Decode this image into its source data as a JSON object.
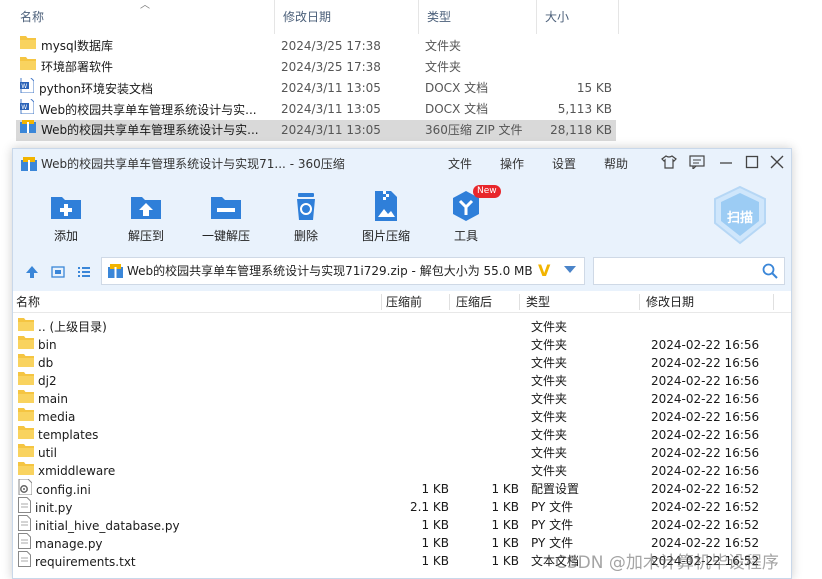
{
  "explorer": {
    "columns": {
      "name": "名称",
      "date": "修改日期",
      "type": "类型",
      "size": "大小"
    },
    "rows": [
      {
        "icon": "folder-icon",
        "name": "mysql数据库",
        "date": "2024/3/25 17:38",
        "type": "文件夹",
        "size": ""
      },
      {
        "icon": "folder-icon",
        "name": "环境部署软件",
        "date": "2024/3/25 17:38",
        "type": "文件夹",
        "size": ""
      },
      {
        "icon": "word-doc-icon",
        "name": "python环境安装文档",
        "date": "2024/3/11 13:05",
        "type": "DOCX 文档",
        "size": "15 KB"
      },
      {
        "icon": "word-doc-icon",
        "name": "Web的校园共享单车管理系统设计与实...",
        "date": "2024/3/11 13:05",
        "type": "DOCX 文档",
        "size": "5,113 KB"
      },
      {
        "icon": "zip-icon",
        "name": "Web的校园共享单车管理系统设计与实...",
        "date": "2024/3/11 13:05",
        "type": "360压缩 ZIP 文件",
        "size": "28,118 KB",
        "selected": true
      }
    ]
  },
  "zip": {
    "title": "Web的校园共享单车管理系统设计与实现71... - 360压缩",
    "menu": [
      "文件",
      "操作",
      "设置",
      "帮助"
    ],
    "toolbar": [
      {
        "icon": "add-icon",
        "label": "添加"
      },
      {
        "icon": "extract-to-icon",
        "label": "解压到"
      },
      {
        "icon": "one-click-extract-icon",
        "label": "一键解压"
      },
      {
        "icon": "delete-icon",
        "label": "删除"
      },
      {
        "icon": "image-compress-icon",
        "label": "图片压缩"
      },
      {
        "icon": "tools-icon",
        "label": "工具",
        "badge": "New"
      }
    ],
    "scan_label": "扫描",
    "address": "Web的校园共享单车管理系统设计与实现71i729.zip - 解包大小为 55.0 MB",
    "search_placeholder": "",
    "columns": {
      "name": "名称",
      "csize": "压缩前",
      "osize": "压缩后",
      "type": "类型",
      "date": "修改日期"
    },
    "rows": [
      {
        "icon": "folder-icon",
        "name": ".. (上级目录)",
        "csize": "",
        "osize": "",
        "type": "文件夹",
        "date": ""
      },
      {
        "icon": "folder-icon",
        "name": "bin",
        "csize": "",
        "osize": "",
        "type": "文件夹",
        "date": "2024-02-22 16:56"
      },
      {
        "icon": "folder-icon",
        "name": "db",
        "csize": "",
        "osize": "",
        "type": "文件夹",
        "date": "2024-02-22 16:56"
      },
      {
        "icon": "folder-icon",
        "name": "dj2",
        "csize": "",
        "osize": "",
        "type": "文件夹",
        "date": "2024-02-22 16:56"
      },
      {
        "icon": "folder-icon",
        "name": "main",
        "csize": "",
        "osize": "",
        "type": "文件夹",
        "date": "2024-02-22 16:56"
      },
      {
        "icon": "folder-icon",
        "name": "media",
        "csize": "",
        "osize": "",
        "type": "文件夹",
        "date": "2024-02-22 16:56"
      },
      {
        "icon": "folder-icon",
        "name": "templates",
        "csize": "",
        "osize": "",
        "type": "文件夹",
        "date": "2024-02-22 16:56"
      },
      {
        "icon": "folder-icon",
        "name": "util",
        "csize": "",
        "osize": "",
        "type": "文件夹",
        "date": "2024-02-22 16:56"
      },
      {
        "icon": "folder-icon",
        "name": "xmiddleware",
        "csize": "",
        "osize": "",
        "type": "文件夹",
        "date": "2024-02-22 16:56"
      },
      {
        "icon": "settings-file-icon",
        "name": "config.ini",
        "csize": "1 KB",
        "osize": "1 KB",
        "type": "配置设置",
        "date": "2024-02-22 16:52"
      },
      {
        "icon": "text-file-icon",
        "name": "init.py",
        "csize": "2.1 KB",
        "osize": "1 KB",
        "type": "PY 文件",
        "date": "2024-02-22 16:52"
      },
      {
        "icon": "text-file-icon",
        "name": "initial_hive_database.py",
        "csize": "1 KB",
        "osize": "1 KB",
        "type": "PY 文件",
        "date": "2024-02-22 16:52"
      },
      {
        "icon": "text-file-icon",
        "name": "manage.py",
        "csize": "1 KB",
        "osize": "1 KB",
        "type": "PY 文件",
        "date": "2024-02-22 16:52"
      },
      {
        "icon": "text-file-icon",
        "name": "requirements.txt",
        "csize": "1 KB",
        "osize": "1 KB",
        "type": "文本文档",
        "date": "2024-02-22 16:52"
      }
    ]
  },
  "watermark": "CSDN @加木计算机毕设程序",
  "colors": {
    "accent": "#2f7fd9",
    "folder": "#f5c542",
    "window_bg": "#e9f2fc",
    "badge": "#e8262b"
  }
}
